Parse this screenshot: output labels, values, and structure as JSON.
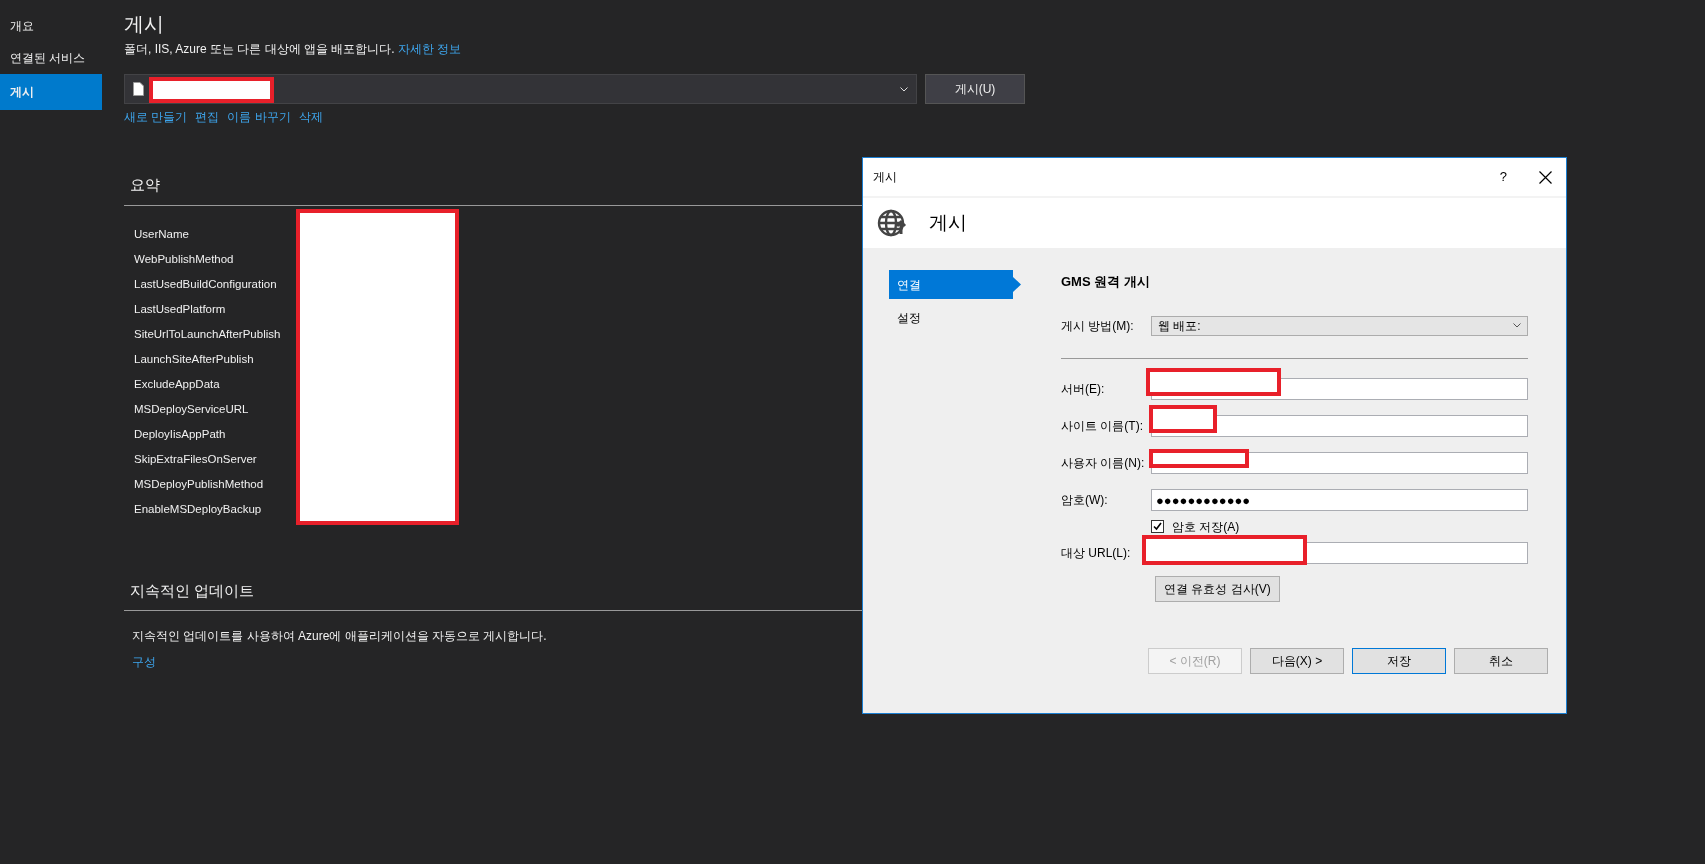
{
  "sidebar": {
    "items": [
      {
        "label": "개요",
        "selected": false
      },
      {
        "label": "연결된 서비스",
        "selected": false
      },
      {
        "label": "게시",
        "selected": true
      }
    ]
  },
  "page": {
    "title": "게시",
    "description": "폴더, IIS, Azure 또는 다른 대상에 앱을 배포합니다.",
    "learn_more_link": "자세한 정보",
    "profile_redacted": true,
    "publish_button": "게시(U)",
    "profile_actions": [
      "새로 만들기",
      "편집",
      "이름 바꾸기",
      "삭제"
    ]
  },
  "summary": {
    "heading": "요약",
    "values_redacted": true,
    "properties": [
      "UserName",
      "WebPublishMethod",
      "LastUsedBuildConfiguration",
      "LastUsedPlatform",
      "SiteUrlToLaunchAfterPublish",
      "LaunchSiteAfterPublish",
      "ExcludeAppData",
      "MSDeployServiceURL",
      "DeployIisAppPath",
      "SkipExtraFilesOnServer",
      "MSDeployPublishMethod",
      "EnableMSDeployBackup"
    ]
  },
  "continuous_update": {
    "heading": "지속적인 업데이트",
    "description": "지속적인 업데이트를 사용하여 Azure에 애플리케이션을 자동으로 게시합니다.",
    "link": "구성"
  },
  "dialog": {
    "title": "게시",
    "help": "?",
    "header": "게시",
    "nav": [
      {
        "label": "연결",
        "selected": true
      },
      {
        "label": "설정",
        "selected": false
      }
    ],
    "profile_name": "GMS 원격 개시",
    "publish_method": {
      "label": "게시 방법(M):",
      "value": "웹 배포:"
    },
    "fields": [
      {
        "label": "서버(E):",
        "redacted": true
      },
      {
        "label": "사이트 이름(T):",
        "redacted": true
      },
      {
        "label": "사용자 이름(N):",
        "redacted": true
      },
      {
        "label": "암호(W):",
        "value": "●●●●●●●●●●●●",
        "redacted": false
      }
    ],
    "save_password": {
      "label": "암호 저장(A)",
      "checked": true
    },
    "destination_url": {
      "label": "대상 URL(L):",
      "redacted": true
    },
    "validate_button": "연결 유효성 검사(V)",
    "buttons": [
      {
        "label": "< 이전(R)",
        "disabled": true,
        "focused": false
      },
      {
        "label": "다음(X) >",
        "disabled": false,
        "focused": false
      },
      {
        "label": "저장",
        "disabled": false,
        "focused": true
      },
      {
        "label": "취소",
        "disabled": false,
        "focused": false
      }
    ]
  }
}
